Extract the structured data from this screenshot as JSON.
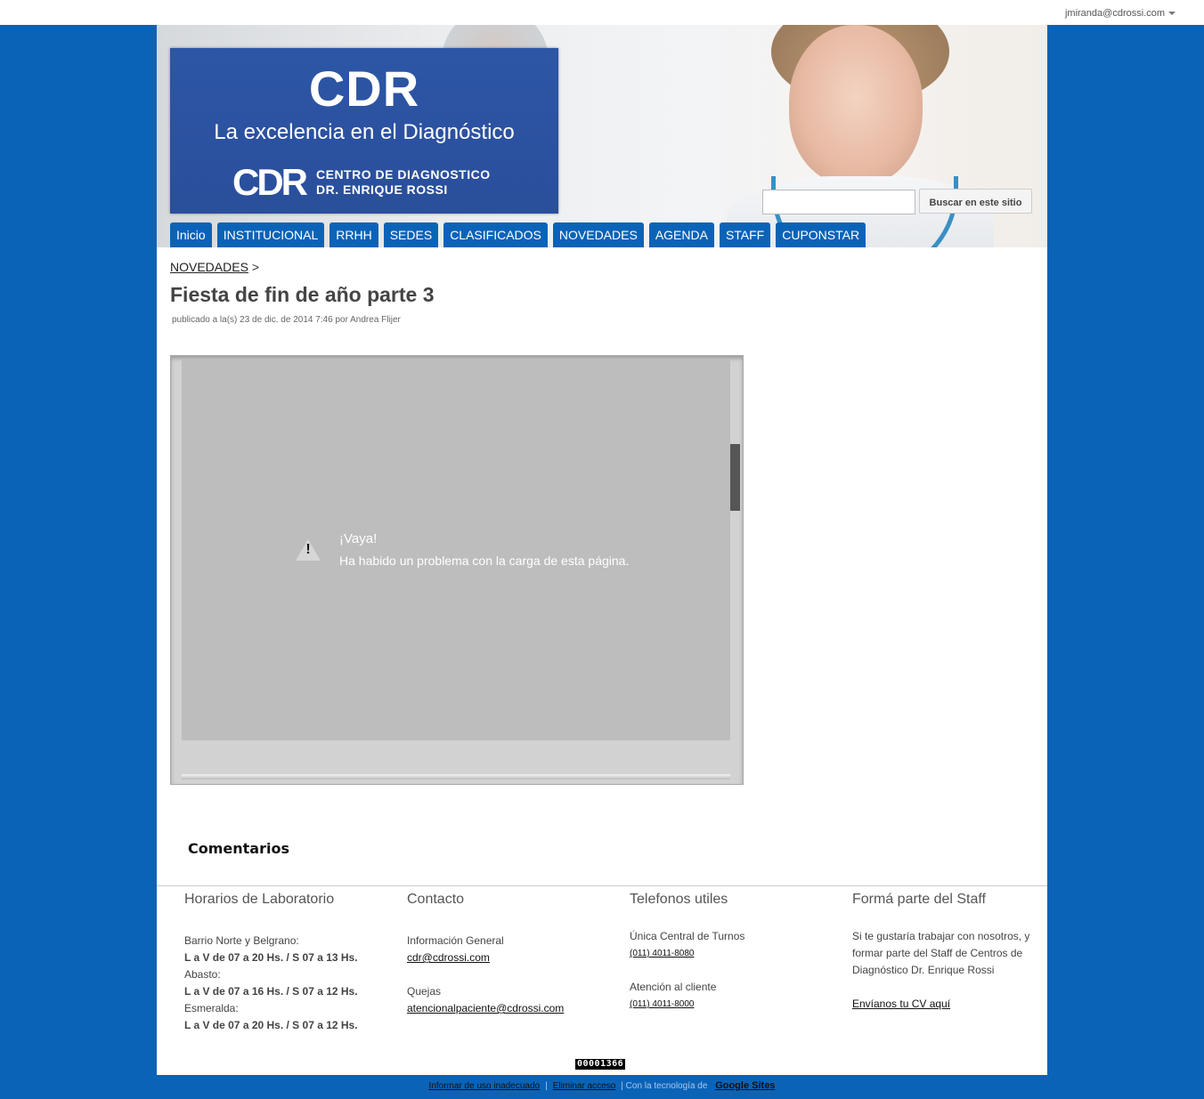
{
  "account": {
    "email": "jmiranda@cdrossi.com"
  },
  "header": {
    "logo_title": "CDR",
    "logo_tagline": "La excelencia en el Diagnóstico",
    "logo_mark": "CDR",
    "logo_org_line1": "CENTRO DE DIAGNOSTICO",
    "logo_org_line2": "DR. ENRIQUE ROSSI"
  },
  "search": {
    "button_label": "Buscar en este sitio",
    "value": ""
  },
  "nav": [
    {
      "label": "Inicio"
    },
    {
      "label": "INSTITUCIONAL"
    },
    {
      "label": "RRHH"
    },
    {
      "label": "SEDES"
    },
    {
      "label": "CLASIFICADOS"
    },
    {
      "label": "NOVEDADES"
    },
    {
      "label": "AGENDA"
    },
    {
      "label": "STAFF"
    },
    {
      "label": "CUPONSTAR"
    }
  ],
  "breadcrumb": {
    "link": "NOVEDADES",
    "separator": ">"
  },
  "post": {
    "title": "Fiesta de fin de año parte 3",
    "meta": "publicado a la(s) 23 de dic. de 2014 7:46 por Andrea Flijer"
  },
  "embed": {
    "error_title": "¡Vaya!",
    "error_message": "Ha habido un problema con la carga de esta página.",
    "icon": "warning-icon"
  },
  "comments_heading": "Comentarios",
  "footer": {
    "horarios": {
      "title": "Horarios de Laboratorio",
      "loc1": "Barrio Norte y Belgrano:",
      "hours1": "L a V de 07 a 20 Hs. / S 07 a 13 Hs.",
      "loc2": "Abasto:",
      "hours2": "L a V de 07 a 16 Hs. / S 07 a 12 Hs.",
      "loc3": "Esmeralda:",
      "hours3": "L a V de 07 a 20 Hs. / S 07 a 12 Hs."
    },
    "contacto": {
      "title": "Contacto",
      "info_label": "Información General",
      "info_email": "cdr@cdrossi.com",
      "quejas_label": "Quejas",
      "quejas_email": "atencionalpaciente@cdrossi.com"
    },
    "telefonos": {
      "title": "Telefonos utiles",
      "turnos_label": "Única Central de Turnos",
      "turnos_phone": "(011) 4011-8080",
      "cliente_label": "Atención al cliente",
      "cliente_phone": "(011) 4011-8000"
    },
    "staff": {
      "title": "Formá parte del Staff",
      "text": "Si te gustaría trabajar con nosotros, y formar parte del Staff de Centros de Diagnóstico Dr. Enrique Rossi",
      "link": "Envíanos tu CV aquí"
    }
  },
  "counter": "00001366",
  "site_footer": {
    "report": "Informar de uso inadecuado",
    "remove": "Eliminar acceso",
    "powered": "Con la tecnología de",
    "gs": "Google Sites"
  },
  "colors": {
    "background": "#0b63b8",
    "nav_tab": "#0b63b8",
    "logo_box": "#2d56a6"
  }
}
